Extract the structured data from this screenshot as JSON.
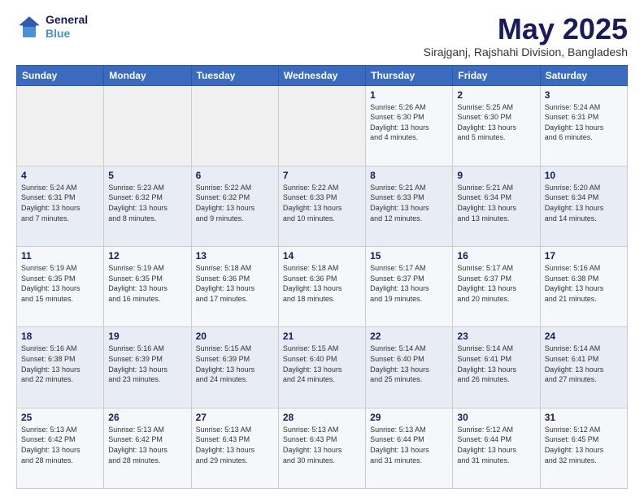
{
  "logo": {
    "line1": "General",
    "line2": "Blue"
  },
  "title": "May 2025",
  "subtitle": "Sirajganj, Rajshahi Division, Bangladesh",
  "headers": [
    "Sunday",
    "Monday",
    "Tuesday",
    "Wednesday",
    "Thursday",
    "Friday",
    "Saturday"
  ],
  "weeks": [
    [
      {
        "day": "",
        "info": ""
      },
      {
        "day": "",
        "info": ""
      },
      {
        "day": "",
        "info": ""
      },
      {
        "day": "",
        "info": ""
      },
      {
        "day": "1",
        "info": "Sunrise: 5:26 AM\nSunset: 6:30 PM\nDaylight: 13 hours\nand 4 minutes."
      },
      {
        "day": "2",
        "info": "Sunrise: 5:25 AM\nSunset: 6:30 PM\nDaylight: 13 hours\nand 5 minutes."
      },
      {
        "day": "3",
        "info": "Sunrise: 5:24 AM\nSunset: 6:31 PM\nDaylight: 13 hours\nand 6 minutes."
      }
    ],
    [
      {
        "day": "4",
        "info": "Sunrise: 5:24 AM\nSunset: 6:31 PM\nDaylight: 13 hours\nand 7 minutes."
      },
      {
        "day": "5",
        "info": "Sunrise: 5:23 AM\nSunset: 6:32 PM\nDaylight: 13 hours\nand 8 minutes."
      },
      {
        "day": "6",
        "info": "Sunrise: 5:22 AM\nSunset: 6:32 PM\nDaylight: 13 hours\nand 9 minutes."
      },
      {
        "day": "7",
        "info": "Sunrise: 5:22 AM\nSunset: 6:33 PM\nDaylight: 13 hours\nand 10 minutes."
      },
      {
        "day": "8",
        "info": "Sunrise: 5:21 AM\nSunset: 6:33 PM\nDaylight: 13 hours\nand 12 minutes."
      },
      {
        "day": "9",
        "info": "Sunrise: 5:21 AM\nSunset: 6:34 PM\nDaylight: 13 hours\nand 13 minutes."
      },
      {
        "day": "10",
        "info": "Sunrise: 5:20 AM\nSunset: 6:34 PM\nDaylight: 13 hours\nand 14 minutes."
      }
    ],
    [
      {
        "day": "11",
        "info": "Sunrise: 5:19 AM\nSunset: 6:35 PM\nDaylight: 13 hours\nand 15 minutes."
      },
      {
        "day": "12",
        "info": "Sunrise: 5:19 AM\nSunset: 6:35 PM\nDaylight: 13 hours\nand 16 minutes."
      },
      {
        "day": "13",
        "info": "Sunrise: 5:18 AM\nSunset: 6:36 PM\nDaylight: 13 hours\nand 17 minutes."
      },
      {
        "day": "14",
        "info": "Sunrise: 5:18 AM\nSunset: 6:36 PM\nDaylight: 13 hours\nand 18 minutes."
      },
      {
        "day": "15",
        "info": "Sunrise: 5:17 AM\nSunset: 6:37 PM\nDaylight: 13 hours\nand 19 minutes."
      },
      {
        "day": "16",
        "info": "Sunrise: 5:17 AM\nSunset: 6:37 PM\nDaylight: 13 hours\nand 20 minutes."
      },
      {
        "day": "17",
        "info": "Sunrise: 5:16 AM\nSunset: 6:38 PM\nDaylight: 13 hours\nand 21 minutes."
      }
    ],
    [
      {
        "day": "18",
        "info": "Sunrise: 5:16 AM\nSunset: 6:38 PM\nDaylight: 13 hours\nand 22 minutes."
      },
      {
        "day": "19",
        "info": "Sunrise: 5:16 AM\nSunset: 6:39 PM\nDaylight: 13 hours\nand 23 minutes."
      },
      {
        "day": "20",
        "info": "Sunrise: 5:15 AM\nSunset: 6:39 PM\nDaylight: 13 hours\nand 24 minutes."
      },
      {
        "day": "21",
        "info": "Sunrise: 5:15 AM\nSunset: 6:40 PM\nDaylight: 13 hours\nand 24 minutes."
      },
      {
        "day": "22",
        "info": "Sunrise: 5:14 AM\nSunset: 6:40 PM\nDaylight: 13 hours\nand 25 minutes."
      },
      {
        "day": "23",
        "info": "Sunrise: 5:14 AM\nSunset: 6:41 PM\nDaylight: 13 hours\nand 26 minutes."
      },
      {
        "day": "24",
        "info": "Sunrise: 5:14 AM\nSunset: 6:41 PM\nDaylight: 13 hours\nand 27 minutes."
      }
    ],
    [
      {
        "day": "25",
        "info": "Sunrise: 5:13 AM\nSunset: 6:42 PM\nDaylight: 13 hours\nand 28 minutes."
      },
      {
        "day": "26",
        "info": "Sunrise: 5:13 AM\nSunset: 6:42 PM\nDaylight: 13 hours\nand 28 minutes."
      },
      {
        "day": "27",
        "info": "Sunrise: 5:13 AM\nSunset: 6:43 PM\nDaylight: 13 hours\nand 29 minutes."
      },
      {
        "day": "28",
        "info": "Sunrise: 5:13 AM\nSunset: 6:43 PM\nDaylight: 13 hours\nand 30 minutes."
      },
      {
        "day": "29",
        "info": "Sunrise: 5:13 AM\nSunset: 6:44 PM\nDaylight: 13 hours\nand 31 minutes."
      },
      {
        "day": "30",
        "info": "Sunrise: 5:12 AM\nSunset: 6:44 PM\nDaylight: 13 hours\nand 31 minutes."
      },
      {
        "day": "31",
        "info": "Sunrise: 5:12 AM\nSunset: 6:45 PM\nDaylight: 13 hours\nand 32 minutes."
      }
    ]
  ]
}
